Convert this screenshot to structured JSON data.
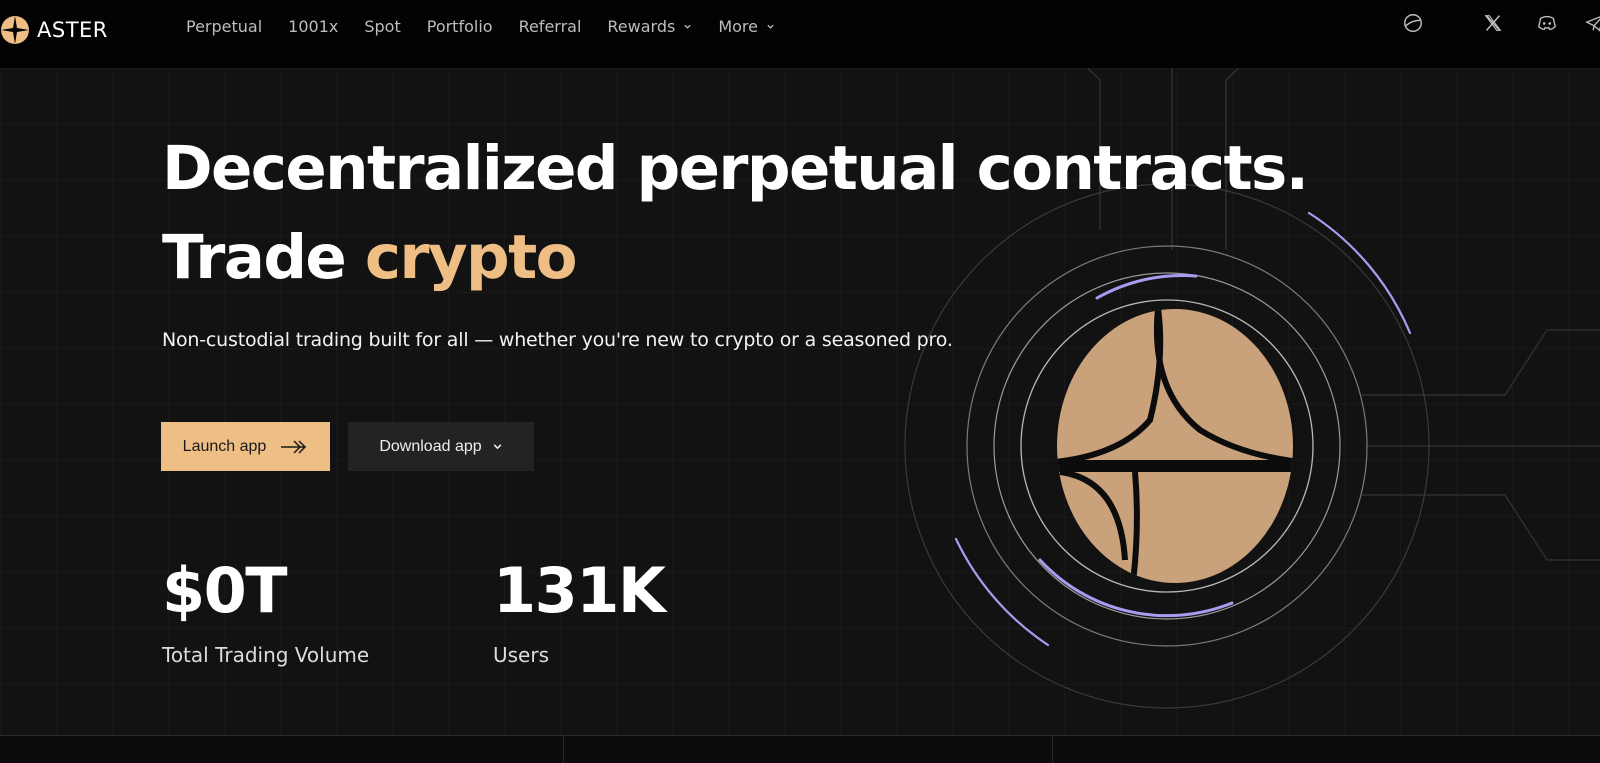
{
  "brand": {
    "name": "ASTER"
  },
  "nav": {
    "items": [
      {
        "label": "Perpetual"
      },
      {
        "label": "1001x"
      },
      {
        "label": "Spot"
      },
      {
        "label": "Portfolio"
      },
      {
        "label": "Referral"
      },
      {
        "label": "Rewards",
        "dropdown": true
      },
      {
        "label": "More",
        "dropdown": true
      }
    ],
    "icons": [
      "globe-icon",
      "x-icon",
      "discord-icon",
      "telegram-icon"
    ]
  },
  "hero": {
    "title_line1": "Decentralized perpetual contracts.",
    "title_line2_prefix": "Trade ",
    "title_line2_accent": "crypto",
    "subtitle": "Non-custodial trading built for all — whether you're new to crypto or a seasoned pro.",
    "launch_label": "Launch app",
    "download_label": "Download app"
  },
  "stats": [
    {
      "value": "$0T",
      "label": "Total Trading Volume"
    },
    {
      "value": "131K",
      "label": "Users"
    }
  ],
  "colors": {
    "accent": "#efbe84",
    "coin": "#c9a27c",
    "ring_glow": "#a99cf0",
    "background": "#121212"
  }
}
